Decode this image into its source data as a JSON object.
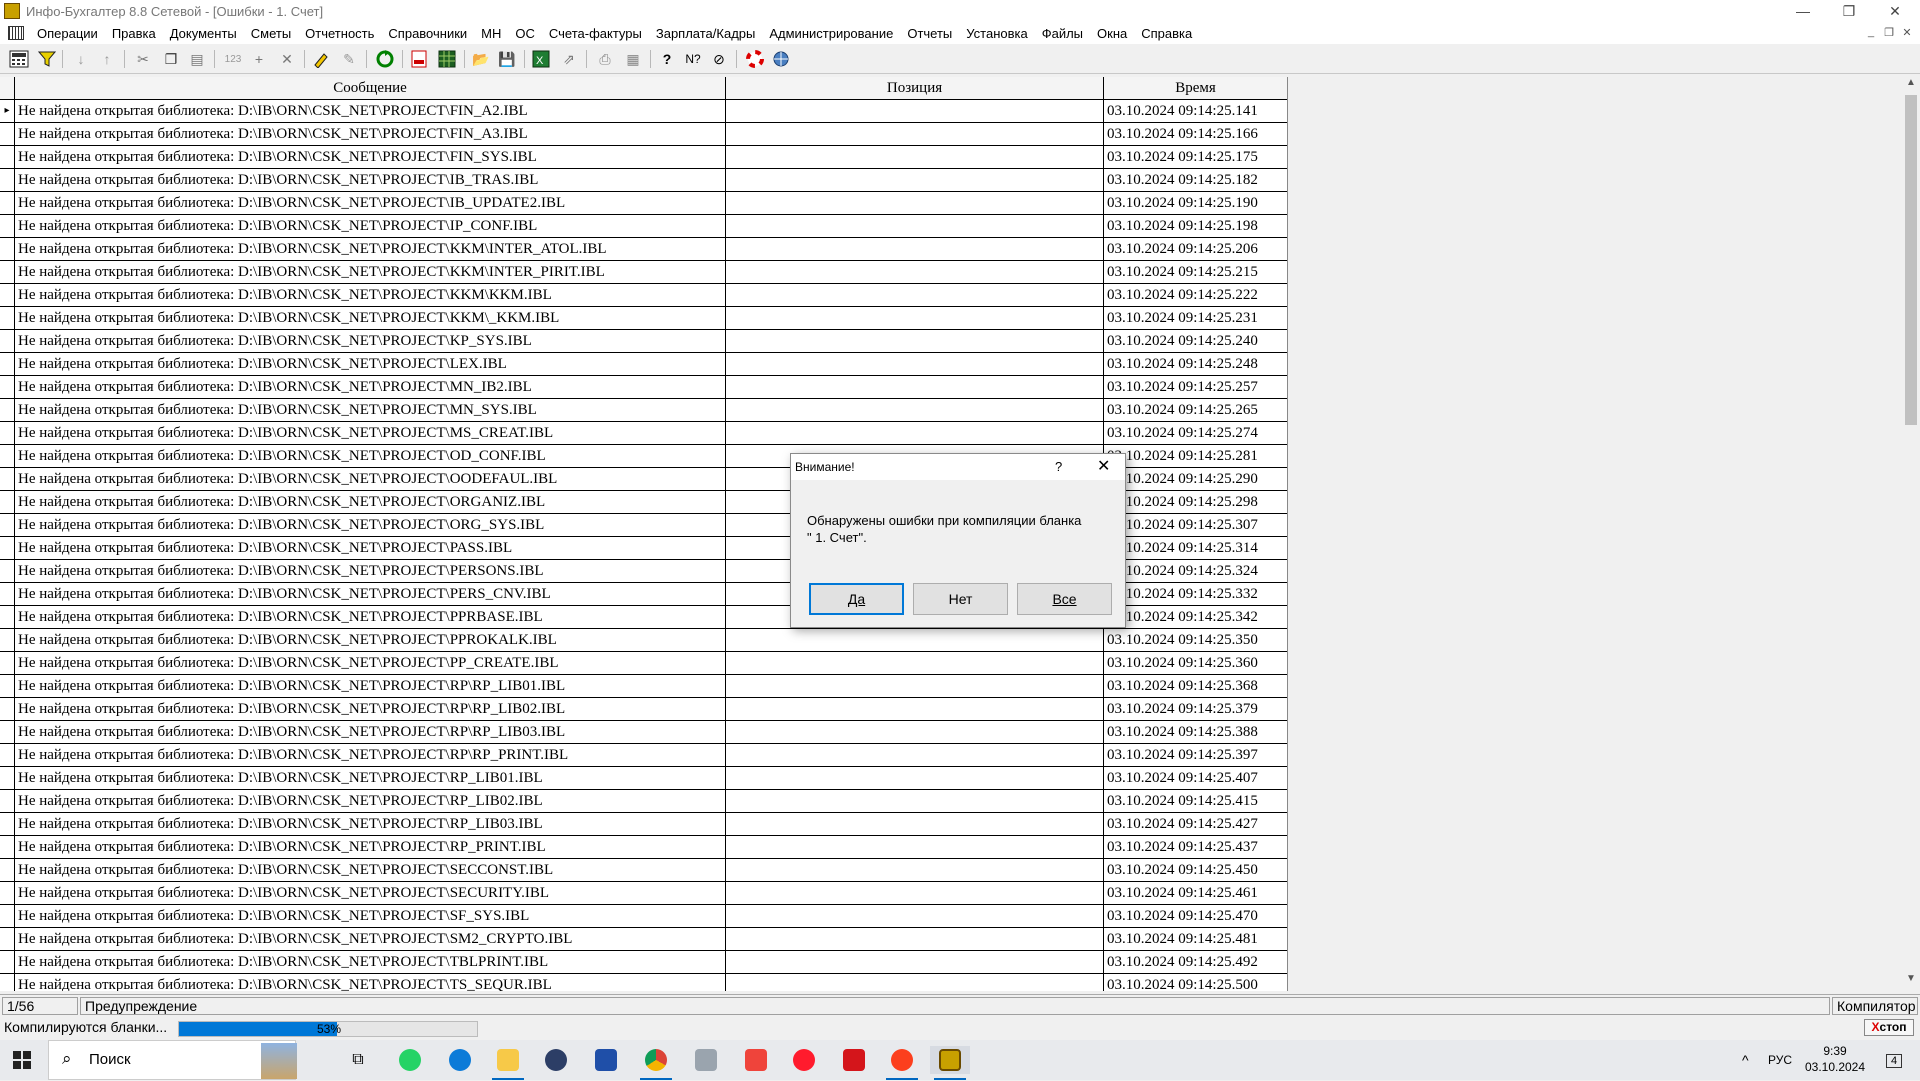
{
  "window": {
    "title": "Инфо-Бухгалтер 8.8 Сетевой - [Ошибки -  1. Счет]",
    "minimize": "—",
    "restore": "❐",
    "close": "✕"
  },
  "menu": [
    "Операции",
    "Правка",
    "Документы",
    "Сметы",
    "Отчетность",
    "Справочники",
    "МН",
    "ОС",
    "Счета-фактуры",
    "Зарплата/Кадры",
    "Администрирование",
    "Отчеты",
    "Установка",
    "Файлы",
    "Окна",
    "Справка"
  ],
  "table": {
    "columns": [
      "Сообщение",
      "Позиция",
      "Время"
    ],
    "rows": [
      {
        "msg": "Не найдена открытая библиотека: D:\\IB\\ORN\\CSK_NET\\PROJECT\\FIN_A2.IBL",
        "pos": "",
        "time": "03.10.2024 09:14:25.141"
      },
      {
        "msg": "Не найдена открытая библиотека: D:\\IB\\ORN\\CSK_NET\\PROJECT\\FIN_A3.IBL",
        "pos": "",
        "time": "03.10.2024 09:14:25.166"
      },
      {
        "msg": "Не найдена открытая библиотека: D:\\IB\\ORN\\CSK_NET\\PROJECT\\FIN_SYS.IBL",
        "pos": "",
        "time": "03.10.2024 09:14:25.175"
      },
      {
        "msg": "Не найдена открытая библиотека: D:\\IB\\ORN\\CSK_NET\\PROJECT\\IB_TRAS.IBL",
        "pos": "",
        "time": "03.10.2024 09:14:25.182"
      },
      {
        "msg": "Не найдена открытая библиотека: D:\\IB\\ORN\\CSK_NET\\PROJECT\\IB_UPDATE2.IBL",
        "pos": "",
        "time": "03.10.2024 09:14:25.190"
      },
      {
        "msg": "Не найдена открытая библиотека: D:\\IB\\ORN\\CSK_NET\\PROJECT\\IP_CONF.IBL",
        "pos": "",
        "time": "03.10.2024 09:14:25.198"
      },
      {
        "msg": "Не найдена открытая библиотека: D:\\IB\\ORN\\CSK_NET\\PROJECT\\KKM\\INTER_ATOL.IBL",
        "pos": "",
        "time": "03.10.2024 09:14:25.206"
      },
      {
        "msg": "Не найдена открытая библиотека: D:\\IB\\ORN\\CSK_NET\\PROJECT\\KKM\\INTER_PIRIT.IBL",
        "pos": "",
        "time": "03.10.2024 09:14:25.215"
      },
      {
        "msg": "Не найдена открытая библиотека: D:\\IB\\ORN\\CSK_NET\\PROJECT\\KKM\\KKM.IBL",
        "pos": "",
        "time": "03.10.2024 09:14:25.222"
      },
      {
        "msg": "Не найдена открытая библиотека: D:\\IB\\ORN\\CSK_NET\\PROJECT\\KKM\\_KKM.IBL",
        "pos": "",
        "time": "03.10.2024 09:14:25.231"
      },
      {
        "msg": "Не найдена открытая библиотека: D:\\IB\\ORN\\CSK_NET\\PROJECT\\KP_SYS.IBL",
        "pos": "",
        "time": "03.10.2024 09:14:25.240"
      },
      {
        "msg": "Не найдена открытая библиотека: D:\\IB\\ORN\\CSK_NET\\PROJECT\\LEX.IBL",
        "pos": "",
        "time": "03.10.2024 09:14:25.248"
      },
      {
        "msg": "Не найдена открытая библиотека: D:\\IB\\ORN\\CSK_NET\\PROJECT\\MN_IB2.IBL",
        "pos": "",
        "time": "03.10.2024 09:14:25.257"
      },
      {
        "msg": "Не найдена открытая библиотека: D:\\IB\\ORN\\CSK_NET\\PROJECT\\MN_SYS.IBL",
        "pos": "",
        "time": "03.10.2024 09:14:25.265"
      },
      {
        "msg": "Не найдена открытая библиотека: D:\\IB\\ORN\\CSK_NET\\PROJECT\\MS_CREAT.IBL",
        "pos": "",
        "time": "03.10.2024 09:14:25.274"
      },
      {
        "msg": "Не найдена открытая библиотека: D:\\IB\\ORN\\CSK_NET\\PROJECT\\OD_CONF.IBL",
        "pos": "",
        "time": "03.10.2024 09:14:25.281"
      },
      {
        "msg": "Не найдена открытая библиотека: D:\\IB\\ORN\\CSK_NET\\PROJECT\\OODEFAUL.IBL",
        "pos": "",
        "time": "03.10.2024 09:14:25.290"
      },
      {
        "msg": "Не найдена открытая библиотека: D:\\IB\\ORN\\CSK_NET\\PROJECT\\ORGANIZ.IBL",
        "pos": "",
        "time": "03.10.2024 09:14:25.298"
      },
      {
        "msg": "Не найдена открытая библиотека: D:\\IB\\ORN\\CSK_NET\\PROJECT\\ORG_SYS.IBL",
        "pos": "",
        "time": "03.10.2024 09:14:25.307"
      },
      {
        "msg": "Не найдена открытая библиотека: D:\\IB\\ORN\\CSK_NET\\PROJECT\\PASS.IBL",
        "pos": "",
        "time": "03.10.2024 09:14:25.314"
      },
      {
        "msg": "Не найдена открытая библиотека: D:\\IB\\ORN\\CSK_NET\\PROJECT\\PERSONS.IBL",
        "pos": "",
        "time": "03.10.2024 09:14:25.324"
      },
      {
        "msg": "Не найдена открытая библиотека: D:\\IB\\ORN\\CSK_NET\\PROJECT\\PERS_CNV.IBL",
        "pos": "",
        "time": "03.10.2024 09:14:25.332"
      },
      {
        "msg": "Не найдена открытая библиотека: D:\\IB\\ORN\\CSK_NET\\PROJECT\\PPRBASE.IBL",
        "pos": "",
        "time": "03.10.2024 09:14:25.342"
      },
      {
        "msg": "Не найдена открытая библиотека: D:\\IB\\ORN\\CSK_NET\\PROJECT\\PPROKALK.IBL",
        "pos": "",
        "time": "03.10.2024 09:14:25.350"
      },
      {
        "msg": "Не найдена открытая библиотека: D:\\IB\\ORN\\CSK_NET\\PROJECT\\PP_CREATE.IBL",
        "pos": "",
        "time": "03.10.2024 09:14:25.360"
      },
      {
        "msg": "Не найдена открытая библиотека: D:\\IB\\ORN\\CSK_NET\\PROJECT\\RP\\RP_LIB01.IBL",
        "pos": "",
        "time": "03.10.2024 09:14:25.368"
      },
      {
        "msg": "Не найдена открытая библиотека: D:\\IB\\ORN\\CSK_NET\\PROJECT\\RP\\RP_LIB02.IBL",
        "pos": "",
        "time": "03.10.2024 09:14:25.379"
      },
      {
        "msg": "Не найдена открытая библиотека: D:\\IB\\ORN\\CSK_NET\\PROJECT\\RP\\RP_LIB03.IBL",
        "pos": "",
        "time": "03.10.2024 09:14:25.388"
      },
      {
        "msg": "Не найдена открытая библиотека: D:\\IB\\ORN\\CSK_NET\\PROJECT\\RP\\RP_PRINT.IBL",
        "pos": "",
        "time": "03.10.2024 09:14:25.397"
      },
      {
        "msg": "Не найдена открытая библиотека: D:\\IB\\ORN\\CSK_NET\\PROJECT\\RP_LIB01.IBL",
        "pos": "",
        "time": "03.10.2024 09:14:25.407"
      },
      {
        "msg": "Не найдена открытая библиотека: D:\\IB\\ORN\\CSK_NET\\PROJECT\\RP_LIB02.IBL",
        "pos": "",
        "time": "03.10.2024 09:14:25.415"
      },
      {
        "msg": "Не найдена открытая библиотека: D:\\IB\\ORN\\CSK_NET\\PROJECT\\RP_LIB03.IBL",
        "pos": "",
        "time": "03.10.2024 09:14:25.427"
      },
      {
        "msg": "Не найдена открытая библиотека: D:\\IB\\ORN\\CSK_NET\\PROJECT\\RP_PRINT.IBL",
        "pos": "",
        "time": "03.10.2024 09:14:25.437"
      },
      {
        "msg": "Не найдена открытая библиотека: D:\\IB\\ORN\\CSK_NET\\PROJECT\\SECCONST.IBL",
        "pos": "",
        "time": "03.10.2024 09:14:25.450"
      },
      {
        "msg": "Не найдена открытая библиотека: D:\\IB\\ORN\\CSK_NET\\PROJECT\\SECURITY.IBL",
        "pos": "",
        "time": "03.10.2024 09:14:25.461"
      },
      {
        "msg": "Не найдена открытая библиотека: D:\\IB\\ORN\\CSK_NET\\PROJECT\\SF_SYS.IBL",
        "pos": "",
        "time": "03.10.2024 09:14:25.470"
      },
      {
        "msg": "Не найдена открытая библиотека: D:\\IB\\ORN\\CSK_NET\\PROJECT\\SM2_CRYPTO.IBL",
        "pos": "",
        "time": "03.10.2024 09:14:25.481"
      },
      {
        "msg": "Не найдена открытая библиотека: D:\\IB\\ORN\\CSK_NET\\PROJECT\\TBLPRINT.IBL",
        "pos": "",
        "time": "03.10.2024 09:14:25.492"
      },
      {
        "msg": "Не найдена открытая библиотека: D:\\IB\\ORN\\CSK_NET\\PROJECT\\TS_SEQUR.IBL",
        "pos": "",
        "time": "03.10.2024 09:14:25.500"
      }
    ]
  },
  "status": {
    "counter": "1/56",
    "type": "Предупреждение",
    "source": "Компилятор"
  },
  "progress": {
    "label": "Компилируются бланки...",
    "percent": 53,
    "percent_text": "53%",
    "stop_x": "X",
    "stop_text": "стоп"
  },
  "dialog": {
    "title": "Внимание!",
    "help": "?",
    "close": "✕",
    "message_line1": "Обнаружены ошибки при компиляции бланка",
    "message_line2": "\"  1. Счет\".",
    "buttons": {
      "yes": "Да",
      "no": "Нет",
      "all": "Все"
    }
  },
  "taskbar": {
    "search_placeholder": "Поиск",
    "lang": "РУС",
    "time": "9:39",
    "date": "03.10.2024",
    "notifications": "4"
  }
}
